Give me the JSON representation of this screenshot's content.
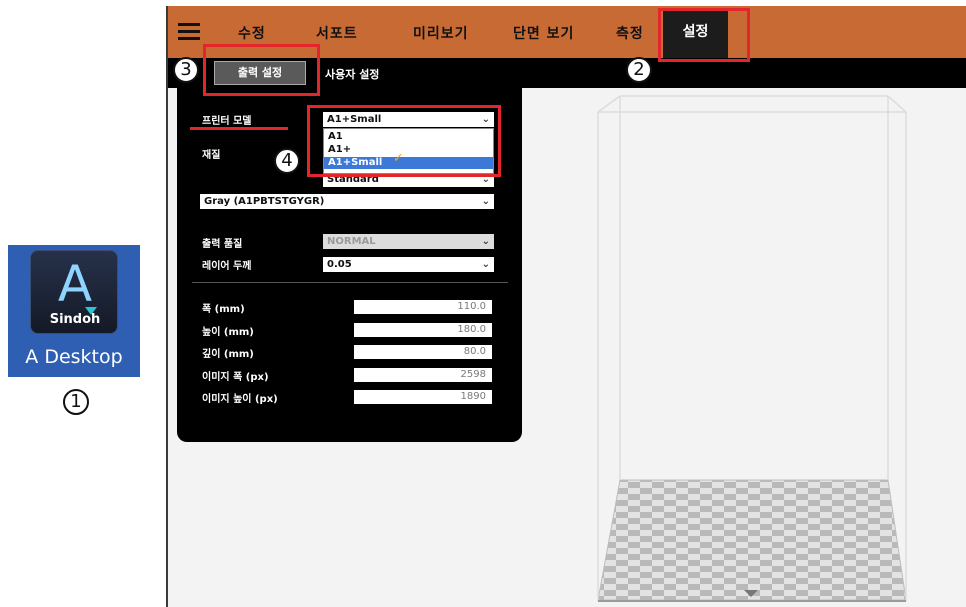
{
  "shortcut": {
    "icon_letter": "A",
    "icon_brand": "Sindoh",
    "label": "A Desktop"
  },
  "badges": {
    "b1": "1",
    "b2": "2",
    "b3": "3",
    "b4": "4"
  },
  "menubar": {
    "tabs": [
      "수정",
      "서포트",
      "미리보기",
      "단면 보기",
      "측정"
    ],
    "active_tab": "설정"
  },
  "subbar": {
    "output_settings": "출력 설정",
    "user_settings": "사용자 설정"
  },
  "panel": {
    "printer_model_label": "프린터 모델",
    "printer_model_value": "A1+Small",
    "printer_model_options": [
      "A1",
      "A1+",
      "A1+Small"
    ],
    "material_label": "재질",
    "material_value": "Standard",
    "filament_value": "Gray (A1PBTSTGYGR)",
    "quality_label": "출력 품질",
    "quality_value": "NORMAL",
    "layer_label": "레이어 두께",
    "layer_value": "0.05",
    "dimensions": [
      {
        "label": "폭 (mm)",
        "value": "110.0"
      },
      {
        "label": "높이 (mm)",
        "value": "180.0"
      },
      {
        "label": "깊이 (mm)",
        "value": "80.0"
      },
      {
        "label": "이미지 폭 (px)",
        "value": "2598"
      },
      {
        "label": "이미지 높이 (px)",
        "value": "1890"
      }
    ]
  },
  "colors": {
    "menubar": "#c86a34",
    "highlight": "#e2262b",
    "selected_option": "#3b78d8",
    "checkmark": "#f4a21c"
  },
  "icons": [
    "hamburger-menu-icon",
    "chevron-down-icon",
    "checkmark-icon",
    "triangle-pointer-icon"
  ]
}
